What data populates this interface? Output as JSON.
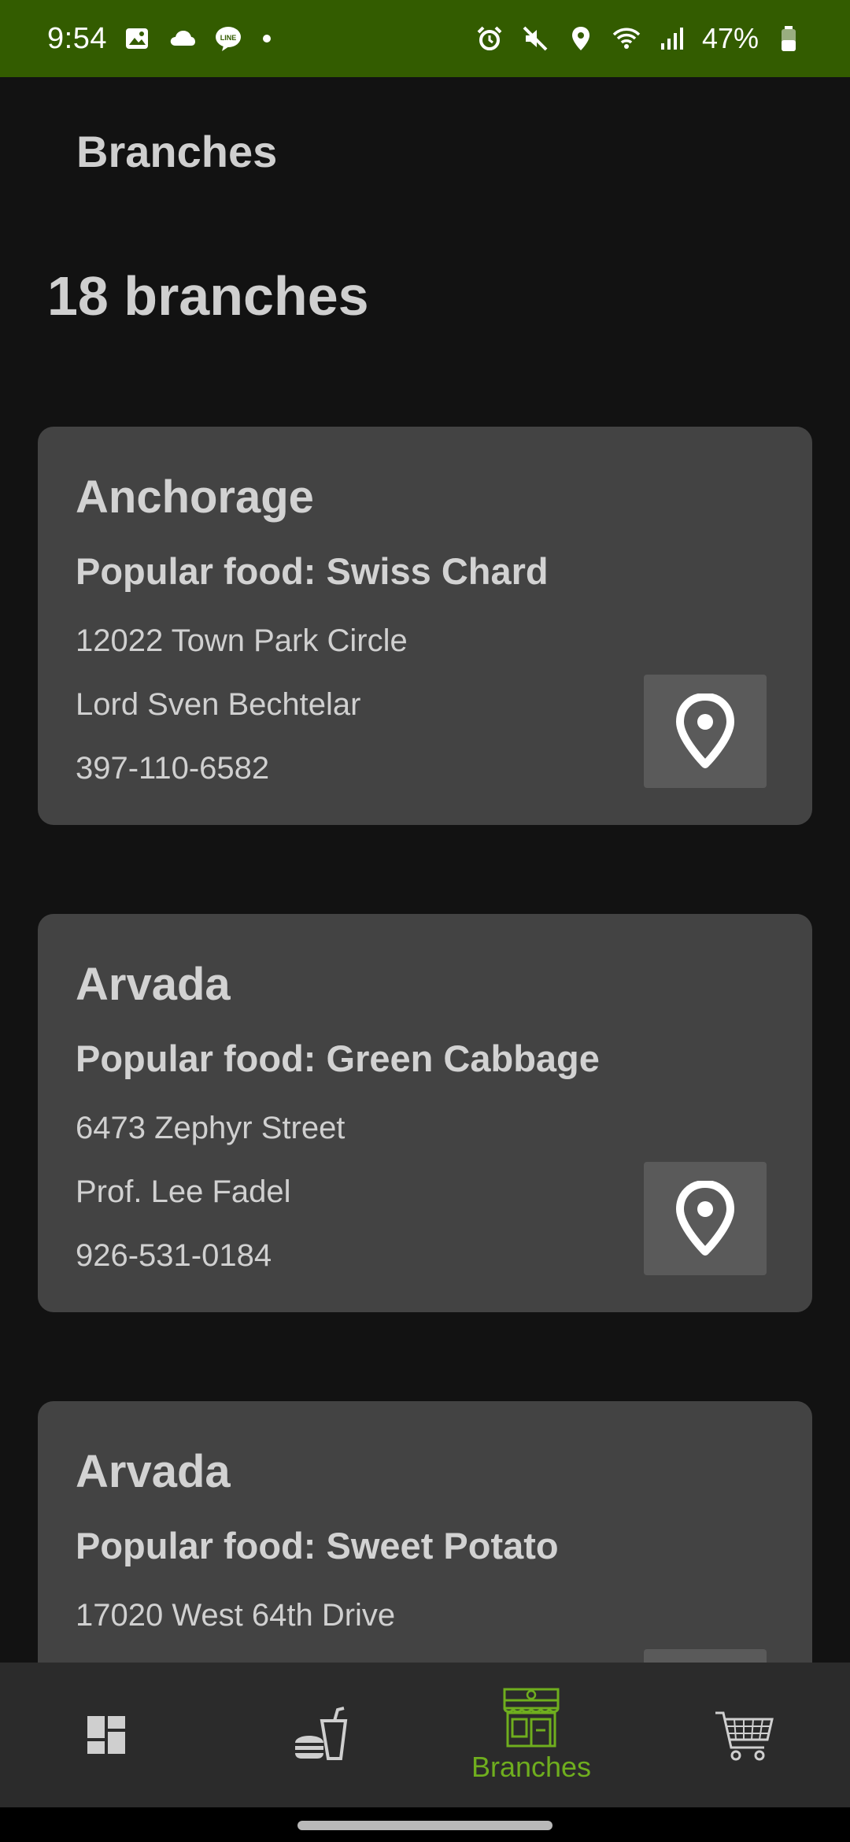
{
  "status_bar": {
    "time": "9:54",
    "battery": "47%",
    "left_icons": [
      "image-icon",
      "cloud-icon",
      "line-app-icon",
      "dot-icon"
    ],
    "right_icons": [
      "alarm-icon",
      "mute-icon",
      "location-icon",
      "wifi-icon",
      "signal-icon",
      "battery-icon"
    ]
  },
  "app_bar": {
    "title": "Branches"
  },
  "branch_count": "18 branches",
  "branches": [
    {
      "city": "Anchorage",
      "popular_food": "Popular food: Swiss Chard",
      "address": "12022 Town Park Circle",
      "manager": "Lord Sven Bechtelar",
      "phone": "397-110-6582"
    },
    {
      "city": "Arvada",
      "popular_food": "Popular food: Green Cabbage",
      "address": "6473 Zephyr Street",
      "manager": "Prof. Lee Fadel",
      "phone": "926-531-0184"
    },
    {
      "city": "Arvada",
      "popular_food": "Popular food: Sweet Potato",
      "address": "17020 West 64th Drive",
      "manager": "",
      "phone": ""
    }
  ],
  "bottom_nav": {
    "items": [
      {
        "icon": "dashboard-icon",
        "label": ""
      },
      {
        "icon": "food-menu-icon",
        "label": ""
      },
      {
        "icon": "store-icon",
        "label": "Branches",
        "active": true
      },
      {
        "icon": "cart-icon",
        "label": ""
      }
    ]
  },
  "colors": {
    "status_bar": "#335c00",
    "background": "#121212",
    "card": "#434343",
    "map_button": "#5a5a5a",
    "nav_bar": "#2b2b2b",
    "accent": "#6fae1e"
  }
}
